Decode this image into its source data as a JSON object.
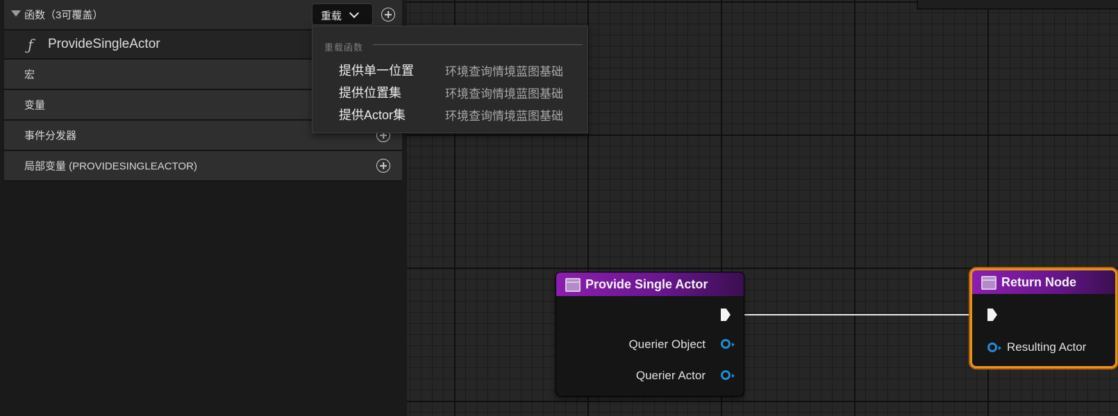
{
  "left_panel": {
    "functions": {
      "label": "函数（3可覆盖）",
      "override_button": "重载",
      "items": [
        {
          "label": "ProvideSingleActor"
        }
      ]
    },
    "macros": {
      "label": "宏"
    },
    "variables": {
      "label": "变量"
    },
    "event_dispatchers": {
      "label": "事件分发器"
    },
    "local_variables": {
      "label": "局部变量 (PROVIDESINGLEACTOR)"
    }
  },
  "override_menu": {
    "section_title": "重载函数",
    "items": [
      {
        "name": "提供单一位置",
        "category": "环境查询情境蓝图基础"
      },
      {
        "name": "提供位置集",
        "category": "环境查询情境蓝图基础"
      },
      {
        "name": "提供Actor集",
        "category": "环境查询情境蓝图基础"
      }
    ]
  },
  "graph": {
    "provide_node": {
      "title": "Provide Single Actor",
      "pins": [
        "Querier Object",
        "Querier Actor"
      ]
    },
    "return_node": {
      "title": "Return Node",
      "pins": [
        "Resulting Actor"
      ]
    }
  },
  "colors": {
    "node_header": "#8b1fae",
    "object_pin": "#1a8fd6",
    "selection_outline": "#e8931a"
  }
}
